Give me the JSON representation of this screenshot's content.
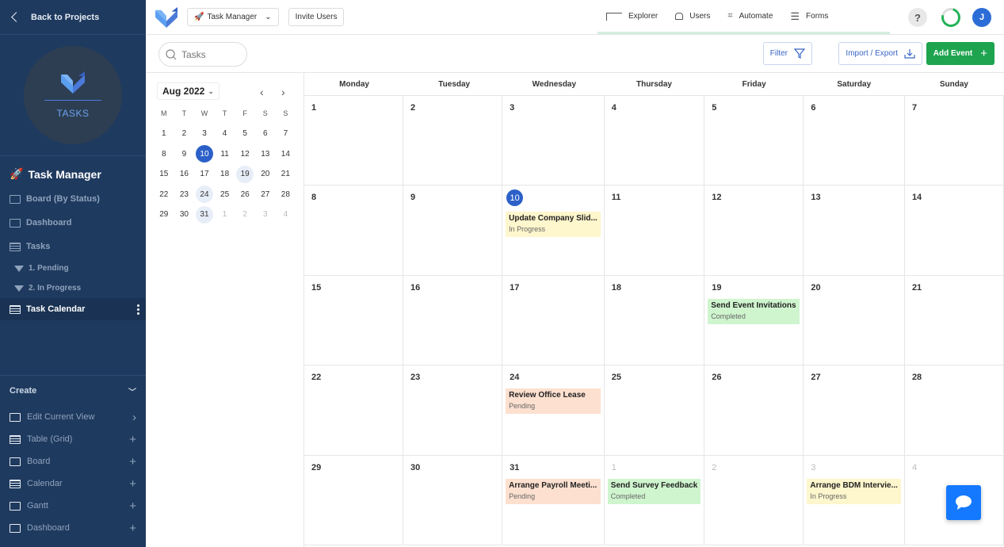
{
  "sidebar": {
    "back_label": "Back to Projects",
    "logo_text": "TASKS",
    "project_title": "Task Manager",
    "project_icon": "rocket-icon",
    "nav": [
      {
        "label": "Board (By Status)",
        "icon": "board-icon"
      },
      {
        "label": "Dashboard",
        "icon": "dashboard-icon"
      },
      {
        "label": "Tasks",
        "icon": "table-icon"
      },
      {
        "label": "1. Pending",
        "icon": "filter-icon"
      },
      {
        "label": "2. In Progress",
        "icon": "filter-icon"
      },
      {
        "label": "Task Calendar",
        "icon": "calendar-icon",
        "active": true
      }
    ],
    "create": {
      "label": "Create",
      "items": [
        {
          "label": "Edit Current View",
          "action": "chevron-right"
        },
        {
          "label": "Table (Grid)",
          "action": "plus"
        },
        {
          "label": "Board",
          "action": "plus"
        },
        {
          "label": "Calendar",
          "action": "plus"
        },
        {
          "label": "Gantt",
          "action": "plus"
        },
        {
          "label": "Dashboard",
          "action": "plus"
        }
      ]
    }
  },
  "topbar": {
    "project_selector": "Task Manager",
    "invite_label": "Invite Users",
    "tabs": [
      "Explorer",
      "Users",
      "Automate",
      "Forms"
    ],
    "help": "?",
    "avatar_initial": "J",
    "colors": {
      "accent": "#2c60c8",
      "success": "#22b257"
    }
  },
  "toolbar": {
    "search_placeholder": "Tasks",
    "filter_label": "Filter",
    "import_export_label": "Import / Export",
    "add_event_label": "Add Event"
  },
  "mini_calendar": {
    "month_label": "Aug 2022",
    "weekdays": [
      "M",
      "T",
      "W",
      "T",
      "F",
      "S",
      "S"
    ],
    "days": [
      [
        "1",
        "2",
        "3",
        "4",
        "5",
        "6",
        "7"
      ],
      [
        "8",
        "9",
        "10",
        "11",
        "12",
        "13",
        "14"
      ],
      [
        "15",
        "16",
        "17",
        "18",
        "19",
        "20",
        "21"
      ],
      [
        "22",
        "23",
        "24",
        "25",
        "26",
        "27",
        "28"
      ],
      [
        "29",
        "30",
        "31",
        "1",
        "2",
        "3",
        "4"
      ]
    ],
    "selected": "10",
    "event_days": [
      "19",
      "24",
      "31"
    ]
  },
  "calendar": {
    "weekdays": [
      "Monday",
      "Tuesday",
      "Wednesday",
      "Thursday",
      "Friday",
      "Saturday",
      "Sunday"
    ],
    "weeks": [
      [
        {
          "d": "1"
        },
        {
          "d": "2"
        },
        {
          "d": "3"
        },
        {
          "d": "4"
        },
        {
          "d": "5"
        },
        {
          "d": "6"
        },
        {
          "d": "7"
        }
      ],
      [
        {
          "d": "8"
        },
        {
          "d": "9"
        },
        {
          "d": "10",
          "today": true,
          "events": [
            {
              "title": "Update Company Slid...",
              "status": "In Progress"
            }
          ]
        },
        {
          "d": "11"
        },
        {
          "d": "12"
        },
        {
          "d": "13"
        },
        {
          "d": "14"
        }
      ],
      [
        {
          "d": "15"
        },
        {
          "d": "16"
        },
        {
          "d": "17"
        },
        {
          "d": "18"
        },
        {
          "d": "19",
          "events": [
            {
              "title": "Send Event Invitations",
              "status": "Completed"
            }
          ]
        },
        {
          "d": "20"
        },
        {
          "d": "21"
        }
      ],
      [
        {
          "d": "22"
        },
        {
          "d": "23"
        },
        {
          "d": "24",
          "events": [
            {
              "title": "Review Office Lease",
              "status": "Pending"
            }
          ]
        },
        {
          "d": "25"
        },
        {
          "d": "26"
        },
        {
          "d": "27"
        },
        {
          "d": "28"
        }
      ],
      [
        {
          "d": "29"
        },
        {
          "d": "30"
        },
        {
          "d": "31",
          "events": [
            {
              "title": "Arrange Payroll Meeti...",
              "status": "Pending"
            }
          ]
        },
        {
          "d": "1",
          "other": true,
          "events": [
            {
              "title": "Send Survey Feedback",
              "status": "Completed"
            }
          ]
        },
        {
          "d": "2",
          "other": true
        },
        {
          "d": "3",
          "other": true,
          "events": [
            {
              "title": "Arrange BDM Intervie...",
              "status": "In Progress"
            }
          ]
        },
        {
          "d": "4",
          "other": true
        }
      ]
    ],
    "status_colors": {
      "Pending": "#fde0cf",
      "In Progress": "#fef6cc",
      "Completed": "#cff5cf"
    }
  }
}
